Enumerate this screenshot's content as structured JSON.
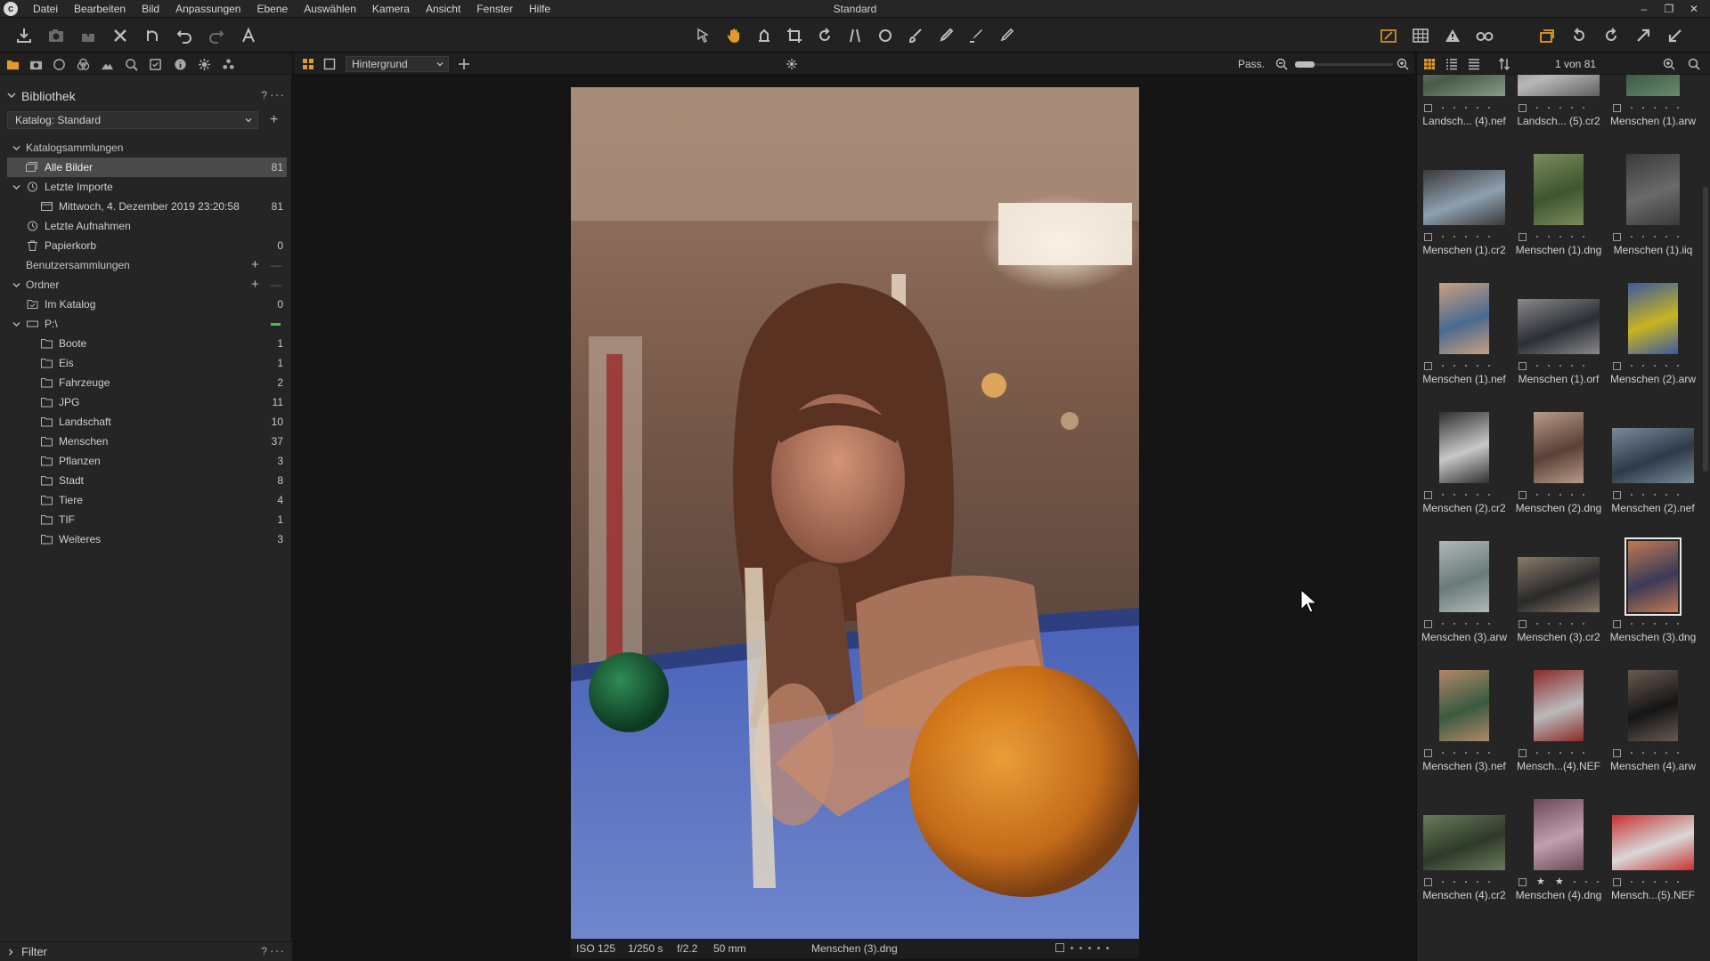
{
  "window": {
    "title": "Standard",
    "menu": [
      "Datei",
      "Bearbeiten",
      "Bild",
      "Anpassungen",
      "Ebene",
      "Auswählen",
      "Kamera",
      "Ansicht",
      "Fenster",
      "Hilfe"
    ],
    "controls": {
      "minimize": "–",
      "restore": "❐",
      "close": "✕"
    }
  },
  "toolbar": {
    "left": [
      "import-icon",
      "capture-icon",
      "export-icon",
      "delete-icon",
      "undo-history-icon",
      "undo-icon",
      "redo-icon",
      "text-icon"
    ],
    "center": [
      "select-icon",
      "pan-icon",
      "hand-icon",
      "crop-icon",
      "rotate-icon",
      "keystone-icon",
      "spot-icon",
      "brush-icon",
      "eraser-icon",
      "draw-icon",
      "pen-icon"
    ],
    "right": [
      "edit-mode-icon",
      "grid-icon",
      "warning-icon",
      "glasses-icon",
      "copy-adjustments-icon",
      "reset-icon",
      "rotate-right-icon",
      "expand-icon",
      "collapse-icon"
    ],
    "colors": {
      "accent": "#e39a2a"
    }
  },
  "library": {
    "title": "Bibliothek",
    "help": "?",
    "more": "···",
    "catalog_select": "Katalog: Standard",
    "add": "+",
    "catalog_collections": {
      "label": "Katalogsammlungen",
      "items": [
        {
          "label": "Alle Bilder",
          "count": "81"
        },
        {
          "label": "Letzte Importe",
          "count": ""
        },
        {
          "label": "Mittwoch, 4. Dezember 2019 23:20:58",
          "count": "81"
        },
        {
          "label": "Letzte Aufnahmen",
          "count": ""
        },
        {
          "label": "Papierkorb",
          "count": "0"
        }
      ]
    },
    "user_collections": {
      "label": "Benutzersammlungen",
      "add": "+",
      "remove": "—"
    },
    "folders": {
      "label": "Ordner",
      "add": "+",
      "remove": "—",
      "in_catalog": {
        "label": "Im Katalog",
        "count": "0"
      },
      "drive": {
        "label": "P:\\"
      },
      "items": [
        {
          "label": "Boote",
          "count": "1"
        },
        {
          "label": "Eis",
          "count": "1"
        },
        {
          "label": "Fahrzeuge",
          "count": "2"
        },
        {
          "label": "JPG",
          "count": "11"
        },
        {
          "label": "Landschaft",
          "count": "10"
        },
        {
          "label": "Menschen",
          "count": "37"
        },
        {
          "label": "Pflanzen",
          "count": "3"
        },
        {
          "label": "Stadt",
          "count": "8"
        },
        {
          "label": "Tiere",
          "count": "4"
        },
        {
          "label": "TIF",
          "count": "1"
        },
        {
          "label": "Weiteres",
          "count": "3"
        }
      ]
    },
    "filter": {
      "label": "Filter",
      "help": "?",
      "more": "···"
    }
  },
  "viewer": {
    "layer_select": "Hintergrund",
    "fit_label": "Pass.",
    "zoom_level": 0.1,
    "info": {
      "iso": "ISO 125",
      "shutter": "1/250 s",
      "aperture": "f/2.2",
      "focal": "50 mm",
      "filename": "Menschen (3).dng"
    }
  },
  "browser": {
    "counter": "1 von 81",
    "thumbnails": [
      {
        "name": "Landsch... (4).nef",
        "rating": 0
      },
      {
        "name": "Landsch... (5).cr2",
        "rating": 0
      },
      {
        "name": "Menschen (1).arw",
        "rating": 0
      },
      {
        "name": "Menschen (1).cr2",
        "rating": 0
      },
      {
        "name": "Menschen (1).dng",
        "rating": 0
      },
      {
        "name": "Menschen (1).iiq",
        "rating": 0
      },
      {
        "name": "Menschen (1).nef",
        "rating": 0
      },
      {
        "name": "Menschen (1).orf",
        "rating": 0
      },
      {
        "name": "Menschen (2).arw",
        "rating": 0
      },
      {
        "name": "Menschen (2).cr2",
        "rating": 0
      },
      {
        "name": "Menschen (2).dng",
        "rating": 0
      },
      {
        "name": "Menschen (2).nef",
        "rating": 0
      },
      {
        "name": "Menschen (3).arw",
        "rating": 0
      },
      {
        "name": "Menschen (3).cr2",
        "rating": 0
      },
      {
        "name": "Menschen (3).dng",
        "rating": 0,
        "selected": true
      },
      {
        "name": "Menschen (3).nef",
        "rating": 0
      },
      {
        "name": "Mensch...(4).NEF",
        "rating": 0
      },
      {
        "name": "Menschen (4).arw",
        "rating": 0
      },
      {
        "name": "Menschen (4).cr2",
        "rating": 0
      },
      {
        "name": "Menschen (4).dng",
        "rating": 2
      },
      {
        "name": "Mensch...(5).NEF",
        "rating": 0
      }
    ]
  }
}
